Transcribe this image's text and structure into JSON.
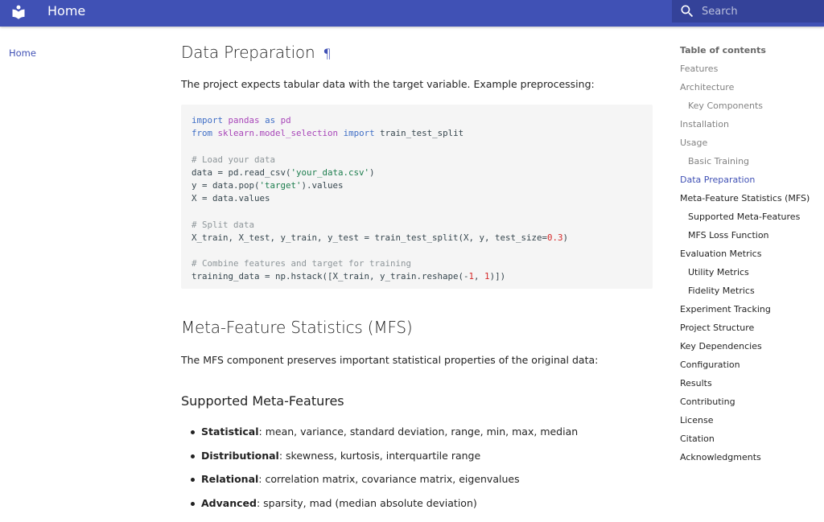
{
  "header": {
    "title": "Home",
    "search_placeholder": "Search",
    "color": "#4051b5"
  },
  "left_nav": {
    "home": "Home"
  },
  "content": {
    "h2_data_prep": "Data Preparation",
    "headerlink": "¶",
    "p1": "The project expects tabular data with the target variable. Example preprocessing:",
    "code_lines": [
      "import pandas as pd",
      "from sklearn.model_selection import train_test_split",
      "",
      "# Load your data",
      "data = pd.read_csv('your_data.csv')",
      "y = data.pop('target').values",
      "X = data.values",
      "",
      "# Split data",
      "X_train, X_test, y_train, y_test = train_test_split(X, y, test_size=0.3)",
      "",
      "# Combine features and target for training",
      "training_data = np.hstack([X_train, y_train.reshape(-1, 1)])"
    ],
    "h2_mfs": "Meta-Feature Statistics (MFS)",
    "p2": "The MFS component preserves important statistical properties of the original data:",
    "h3_supported": "Supported Meta-Features",
    "bullets": [
      {
        "term": "Statistical",
        "desc": ": mean, variance, standard deviation, range, min, max, median"
      },
      {
        "term": "Distributional",
        "desc": ": skewness, kurtosis, interquartile range"
      },
      {
        "term": "Relational",
        "desc": ": correlation matrix, covariance matrix, eigenvalues"
      },
      {
        "term": "Advanced",
        "desc": ": sparsity, mad (median absolute deviation)"
      }
    ]
  },
  "toc": {
    "title": "Table of contents",
    "items": [
      {
        "label": "Features",
        "level": 1,
        "state": "muted"
      },
      {
        "label": "Architecture",
        "level": 1,
        "state": "muted"
      },
      {
        "label": "Key Components",
        "level": 2,
        "state": "muted"
      },
      {
        "label": "Installation",
        "level": 1,
        "state": "muted"
      },
      {
        "label": "Usage",
        "level": 1,
        "state": "muted"
      },
      {
        "label": "Basic Training",
        "level": 2,
        "state": "muted"
      },
      {
        "label": "Data Preparation",
        "level": 1,
        "state": "active"
      },
      {
        "label": "Meta-Feature Statistics (MFS)",
        "level": 1,
        "state": "dark"
      },
      {
        "label": "Supported Meta-Features",
        "level": 2,
        "state": "dark"
      },
      {
        "label": "MFS Loss Function",
        "level": 2,
        "state": "dark"
      },
      {
        "label": "Evaluation Metrics",
        "level": 1,
        "state": "dark"
      },
      {
        "label": "Utility Metrics",
        "level": 2,
        "state": "dark"
      },
      {
        "label": "Fidelity Metrics",
        "level": 2,
        "state": "dark"
      },
      {
        "label": "Experiment Tracking",
        "level": 1,
        "state": "dark"
      },
      {
        "label": "Project Structure",
        "level": 1,
        "state": "dark"
      },
      {
        "label": "Key Dependencies",
        "level": 1,
        "state": "dark"
      },
      {
        "label": "Configuration",
        "level": 1,
        "state": "dark"
      },
      {
        "label": "Results",
        "level": 1,
        "state": "dark"
      },
      {
        "label": "Contributing",
        "level": 1,
        "state": "dark"
      },
      {
        "label": "License",
        "level": 1,
        "state": "dark"
      },
      {
        "label": "Citation",
        "level": 1,
        "state": "dark"
      },
      {
        "label": "Acknowledgments",
        "level": 1,
        "state": "dark"
      }
    ]
  }
}
